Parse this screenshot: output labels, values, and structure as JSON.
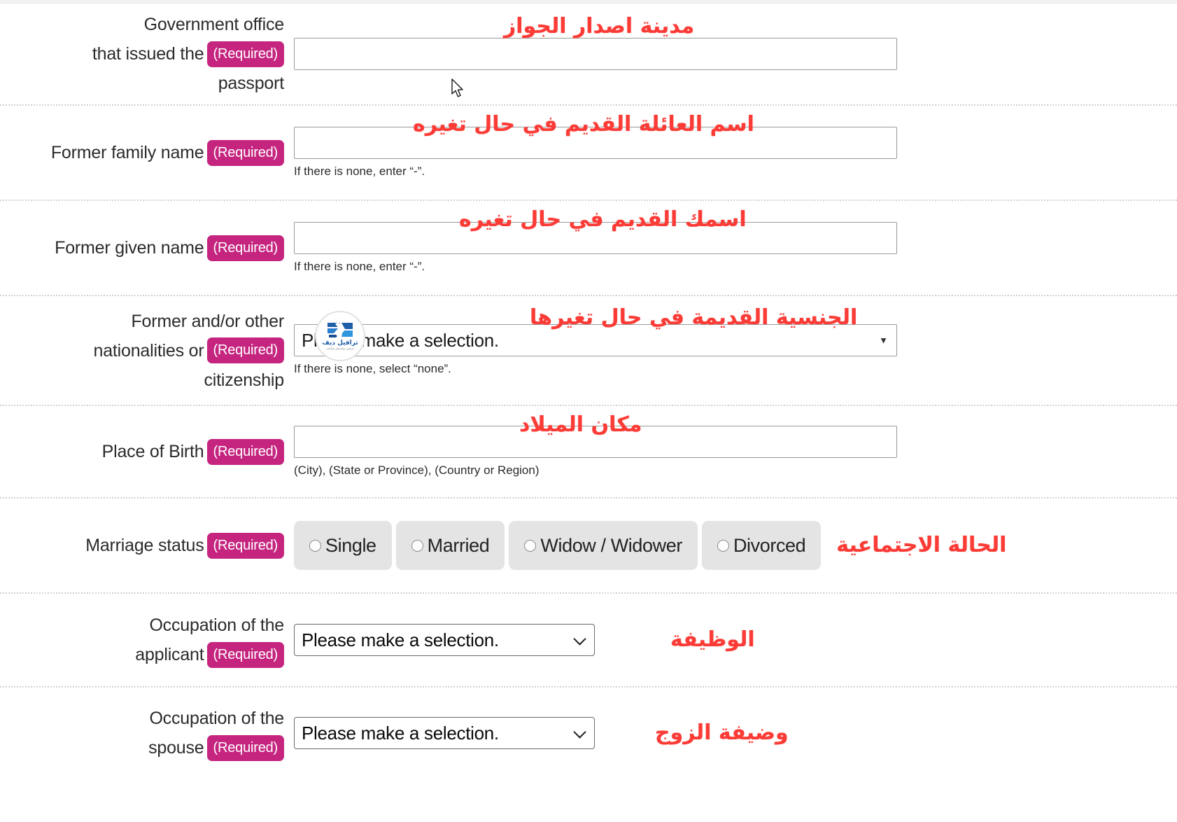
{
  "colors": {
    "required_badge_bg": "#c5257f",
    "annotation_red": "#fb3b36",
    "label_text": "#2b2b2b",
    "row_divider": "#d2d2d2",
    "radio_pill_bg": "#e4e4e4",
    "watermark_blue": "#1f5fa8"
  },
  "watermark": {
    "name": "ترافيل ديف",
    "tagline": "درجتي وخدمتر ميامت"
  },
  "required_badge": "(Required)",
  "select_placeholder": "Please make a selection.",
  "rows": [
    {
      "id": "government-office-passport",
      "label": "Government office that issued the passport",
      "label_lines": [
        "Government office",
        "that issued the",
        "passport"
      ],
      "required": true,
      "control": "text",
      "value": "",
      "annotation": "مدينة اصدار الجواز",
      "hint": ""
    },
    {
      "id": "former-family-name",
      "label": "Former family name",
      "label_lines": [
        "Former family name"
      ],
      "required": true,
      "control": "text",
      "value": "",
      "annotation": "اسم العائلة القديم في حال تغيره",
      "hint": "If there is none, enter “-”."
    },
    {
      "id": "former-given-name",
      "label": "Former given name",
      "label_lines": [
        "Former given name"
      ],
      "required": true,
      "control": "text",
      "value": "",
      "annotation": "اسمك القديم في حال تغيره",
      "hint": "If there is none, enter “-”."
    },
    {
      "id": "former-other-nationalities",
      "label": "Former and/or other nationalities or citizenship",
      "label_lines": [
        "Former and/or other",
        "nationalities or",
        "citizenship"
      ],
      "required": true,
      "control": "fancy-select",
      "value": "Please make a selection.",
      "annotation": "الجنسية القديمة في حال تغيرها",
      "hint": "If there is none, select “none”."
    },
    {
      "id": "place-of-birth",
      "label": "Place of Birth",
      "label_lines": [
        "Place of Birth"
      ],
      "required": true,
      "control": "text",
      "value": "",
      "annotation": "مكان الميلاد",
      "hint": "(City), (State or Province), (Country or Region)"
    },
    {
      "id": "marriage-status",
      "label": "Marriage status",
      "label_lines": [
        "Marriage status"
      ],
      "required": true,
      "control": "radio",
      "options": [
        "Single",
        "Married",
        "Widow / Widower",
        "Divorced"
      ],
      "selected": "",
      "annotation": "الحالة الاجتماعية",
      "hint": ""
    },
    {
      "id": "occupation-applicant",
      "label": "Occupation of the applicant",
      "label_lines": [
        "Occupation of the",
        "applicant"
      ],
      "required": true,
      "control": "native-select",
      "value": "Please make a selection.",
      "annotation": "الوظيفة",
      "hint": ""
    },
    {
      "id": "occupation-spouse",
      "label": "Occupation of the spouse",
      "label_lines": [
        "Occupation of the",
        "spouse"
      ],
      "required": true,
      "control": "native-select",
      "value": "Please make a selection.",
      "annotation": "وضيفة الزوج",
      "hint": ""
    }
  ]
}
